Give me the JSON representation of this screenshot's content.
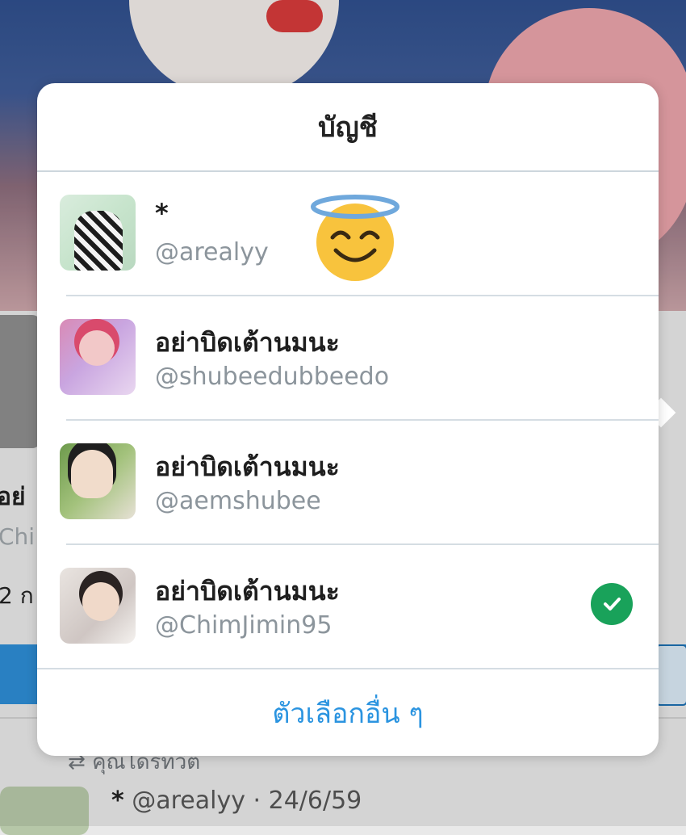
{
  "background": {
    "name_fragment": "อย่",
    "handle_fragment": "Chi",
    "count_fragment": "2 ก",
    "retweet_text": "คุณได้รีทวีต",
    "tweet": {
      "star": "*",
      "meta": "@arealyy · 24/6/59"
    }
  },
  "sheet": {
    "title": "บัญชี",
    "accounts": [
      {
        "name": "*",
        "handle": "@arealyy",
        "selected": false
      },
      {
        "name": "อย่าบิดเต้านมนะ",
        "handle": "@shubeedubbeedo",
        "selected": false
      },
      {
        "name": "อย่าบิดเต้านมนะ",
        "handle": "@aemshubee",
        "selected": false
      },
      {
        "name": "อย่าบิดเต้านมนะ",
        "handle": "@ChimJimin95",
        "selected": true
      }
    ],
    "other_options_label": "ตัวเลือกอื่น ๆ"
  },
  "colors": {
    "accent": "#2b94e0",
    "check_green": "#19a25a",
    "twitter_blue": "#2d8bd3"
  },
  "icons": {
    "emoji": "smiling-face-with-halo-icon",
    "selected": "checkmark-circle-icon"
  }
}
